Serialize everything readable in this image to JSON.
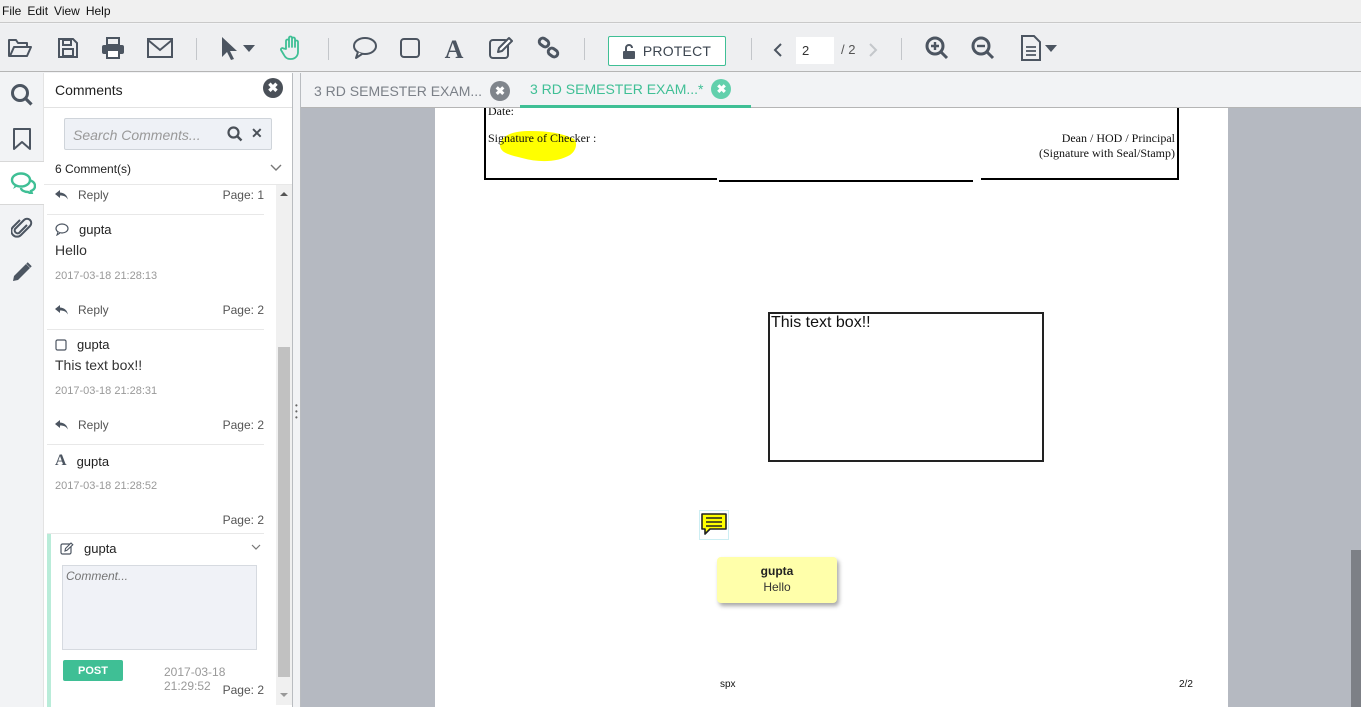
{
  "menu": [
    "File",
    "Edit",
    "View",
    "Help"
  ],
  "toolbar": {
    "protect_label": "PROTECT",
    "page_current": "2",
    "page_total": "/ 2",
    "accent_color": "#3fbf95"
  },
  "tabs": [
    {
      "label": "3 RD SEMESTER EXAM...",
      "active": false
    },
    {
      "label": "3 RD SEMESTER EXAM...*",
      "active": true
    }
  ],
  "panel": {
    "title": "Comments",
    "search_placeholder": "Search Comments...",
    "count_label": "6 Comment(s)",
    "comments": [
      {
        "type": "reply-row",
        "reply": "Reply",
        "page": "Page: 1"
      },
      {
        "type": "note",
        "icon": "speech-bubble-icon",
        "author": "gupta",
        "text": "Hello",
        "timestamp": "2017-03-18 21:28:13",
        "reply": "Reply",
        "page": "Page: 2"
      },
      {
        "type": "rectangle",
        "icon": "square-icon",
        "author": "gupta",
        "text": "This text box!!",
        "timestamp": "2017-03-18 21:28:31",
        "reply": "Reply",
        "page": "Page: 2"
      },
      {
        "type": "text",
        "icon": "text-icon",
        "author": "gupta",
        "timestamp": "2017-03-18 21:28:52",
        "page": "Page: 2"
      },
      {
        "type": "highlight",
        "icon": "edit-icon",
        "author": "gupta",
        "comment_placeholder": "Comment...",
        "post_label": "POST",
        "timestamp": "2017-03-18 21:29:52",
        "page": "Page: 2"
      }
    ]
  },
  "document": {
    "date_label": "Date:",
    "checker_label": "Signature of Checker :",
    "dean_label": "Dean / HOD / Principal",
    "seal_label": "(Signature with Seal/Stamp)",
    "textbox_text": "This text box!!",
    "sticky_author": "gupta",
    "sticky_text": "Hello",
    "footer_left": "spx",
    "footer_right": "2/2",
    "highlight_color": "#ffff00"
  }
}
